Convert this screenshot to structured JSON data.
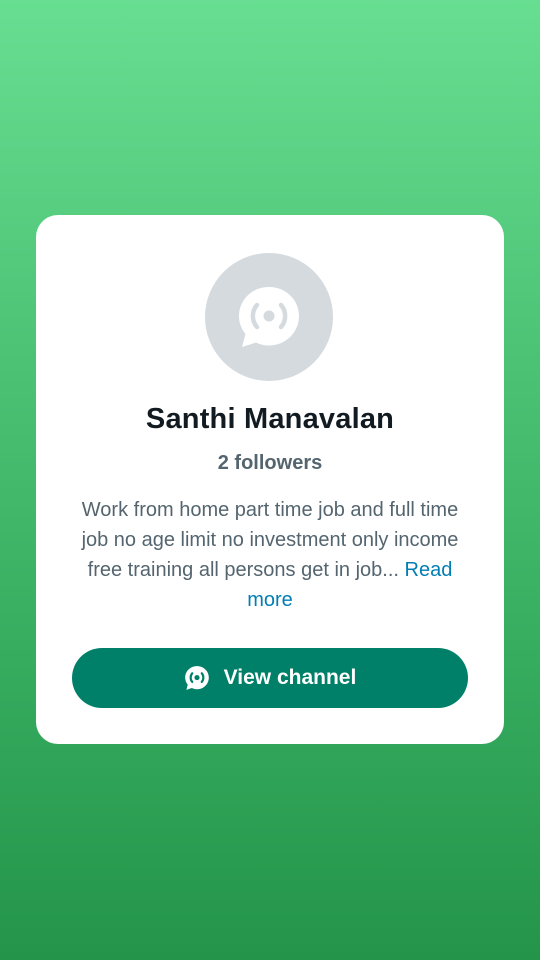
{
  "channel": {
    "name": "Santhi Manavalan",
    "followers": "2 followers",
    "description": "Work from home part time job and full time job no age limit no investment only income free training all persons get in job...",
    "read_more": "Read more",
    "avatar_icon": "channel-broadcast-icon"
  },
  "actions": {
    "view_channel_label": "View channel",
    "view_channel_icon": "channel-icon"
  },
  "colors": {
    "background_top": "#67de91",
    "background_bottom": "#24944a",
    "card": "#ffffff",
    "primary_button": "#008069",
    "link": "#027eb5",
    "avatar_bg": "#d5dade",
    "title_text": "#111b21",
    "secondary_text": "#54656f"
  }
}
